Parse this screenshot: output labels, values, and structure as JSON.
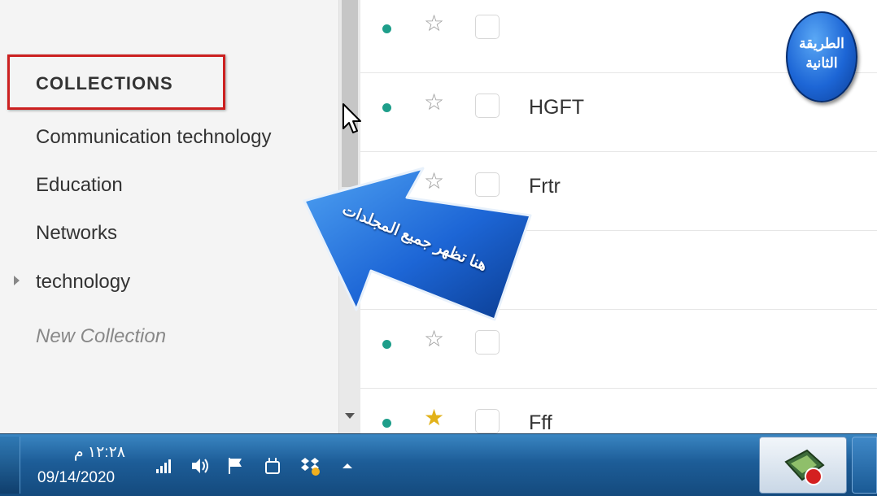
{
  "sidebar": {
    "section_header": "COLLECTIONS",
    "collections": [
      {
        "label": "Communication technology",
        "expandable": false
      },
      {
        "label": "Education",
        "expandable": false
      },
      {
        "label": "Networks",
        "expandable": false
      },
      {
        "label": "technology",
        "expandable": true
      }
    ],
    "new_collection": "New Collection"
  },
  "messages": [
    {
      "subject": "",
      "starred": false
    },
    {
      "subject": "HGFT",
      "starred": false
    },
    {
      "subject": "Frtr",
      "starred": false
    },
    {
      "subject": "",
      "starred": false
    },
    {
      "subject": "",
      "starred": false
    },
    {
      "subject": "Fff",
      "starred": true
    }
  ],
  "annotations": {
    "arrow_text": "هنا تظهر جميع المجلدات",
    "badge_line1": "الطريقة",
    "badge_line2": "الثانية"
  },
  "taskbar": {
    "time": "١٢:٢٨ م",
    "date": "09/14/2020",
    "tray_icons": [
      "signal-icon",
      "volume-icon",
      "flag-icon",
      "power-icon",
      "dropbox-icon",
      "show-hidden-icons-chevron"
    ]
  },
  "colors": {
    "unread_dot": "#1e9e8a",
    "star_active": "#e2b21a",
    "highlight_box": "#cc2020",
    "callout_blue": "#1d66d6"
  }
}
